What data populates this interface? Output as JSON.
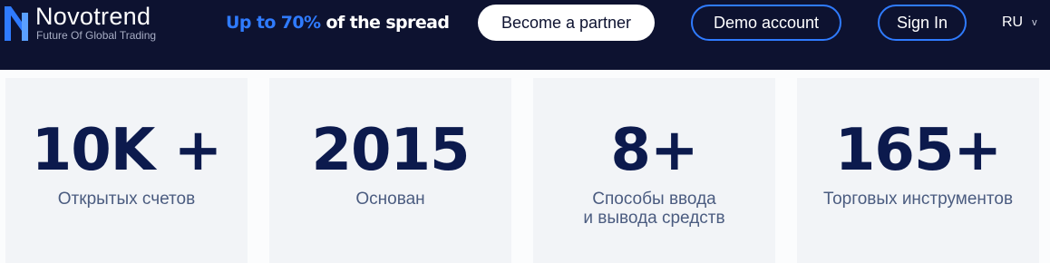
{
  "header": {
    "logo_name": "Novotrend",
    "logo_tagline": "Future Of Global Trading",
    "promo_accent": "Up to 70%",
    "promo_rest": " of the spread",
    "partner_button": "Become a partner",
    "demo_button": "Demo account",
    "signin_button": "Sign In",
    "language": "RU",
    "language_chevron": "v"
  },
  "stats": [
    {
      "value": "10K +",
      "label": "Открытых счетов"
    },
    {
      "value": "2015",
      "label": "Основан"
    },
    {
      "value": "8+",
      "label": "Способы ввода\nи вывода средств"
    },
    {
      "value": "165+",
      "label": "Торговых инструментов"
    }
  ],
  "colors": {
    "header_bg": "#0d1230",
    "accent": "#2f7bff",
    "stat_value": "#0c1a4d",
    "stat_label": "#4b5c80",
    "card_bg": "#f2f4f7"
  },
  "icons": {
    "logo": "novotrend-logo-icon",
    "language_dropdown": "chevron-down-icon"
  }
}
